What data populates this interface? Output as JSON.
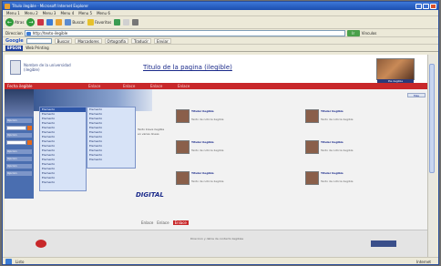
{
  "window": {
    "title": "Titulo ilegible - Microsoft Internet Explorer"
  },
  "menubar": [
    "Menu 1",
    "Menu 2",
    "Menu 3",
    "Menu 4",
    "Menu 5",
    "Menu 6"
  ],
  "toolbar": {
    "back": "Atras",
    "search": "Buscar",
    "favorites": "Favoritos"
  },
  "address": {
    "label": "Direccion",
    "url": "http://texto-ilegible",
    "go": "Ir",
    "links": "Vinculos"
  },
  "google": {
    "logo": "Google",
    "chips": [
      "Buscar",
      "Marcadores",
      "Ortografia",
      "Traducir",
      "Enviar"
    ]
  },
  "epson": {
    "logo": "EPSON",
    "item": "Web Printing"
  },
  "header": {
    "university": "Nombre de la universidad (ilegible)",
    "title": "Titulo de la pagina (ilegible)",
    "caption": "Pie ilegible"
  },
  "nav": {
    "date": "Fecha ilegible",
    "links": [
      "Enlace",
      "Enlace",
      "Enlace",
      "Enlace"
    ]
  },
  "sidebar": {
    "items": [
      "Opcion",
      "Opcion",
      "Opcion",
      "Opcion",
      "Opcion",
      "Opcion"
    ]
  },
  "menu1": [
    "Elemento",
    "Elemento",
    "Elemento",
    "Elemento",
    "Elemento",
    "Elemento",
    "Elemento",
    "Elemento",
    "Elemento",
    "Elemento",
    "Elemento",
    "Elemento",
    "Elemento",
    "Elemento",
    "Elemento",
    "Elemento",
    "Elemento"
  ],
  "menu2": [
    "Elemento",
    "Elemento",
    "Elemento",
    "Elemento",
    "Elemento",
    "Elemento",
    "Elemento",
    "Elemento",
    "Elemento",
    "Elemento",
    "Elemento",
    "Elemento"
  ],
  "mid": {
    "text": "Texto breve ilegible en varias lineas",
    "digital": "DIGITAL"
  },
  "news": [
    {
      "title": "Titular ilegible",
      "body": "Texto de noticia ilegible"
    },
    {
      "title": "Titular ilegible",
      "body": "Texto de noticia ilegible"
    },
    {
      "title": "Titular ilegible",
      "body": "Texto de noticia ilegible"
    },
    {
      "title": "Titular ilegible",
      "body": "Texto de noticia ilegible"
    },
    {
      "title": "Titular ilegible",
      "body": "Texto de noticia ilegible"
    },
    {
      "title": "Titular ilegible",
      "body": "Texto de noticia ilegible"
    }
  ],
  "more": "Mas",
  "footer": {
    "links": [
      "Enlace",
      "Enlace"
    ],
    "badge": "Enlace",
    "text": "Direccion y datos de contacto ilegibles"
  },
  "status": {
    "text": "Listo",
    "zone": "Internet"
  }
}
